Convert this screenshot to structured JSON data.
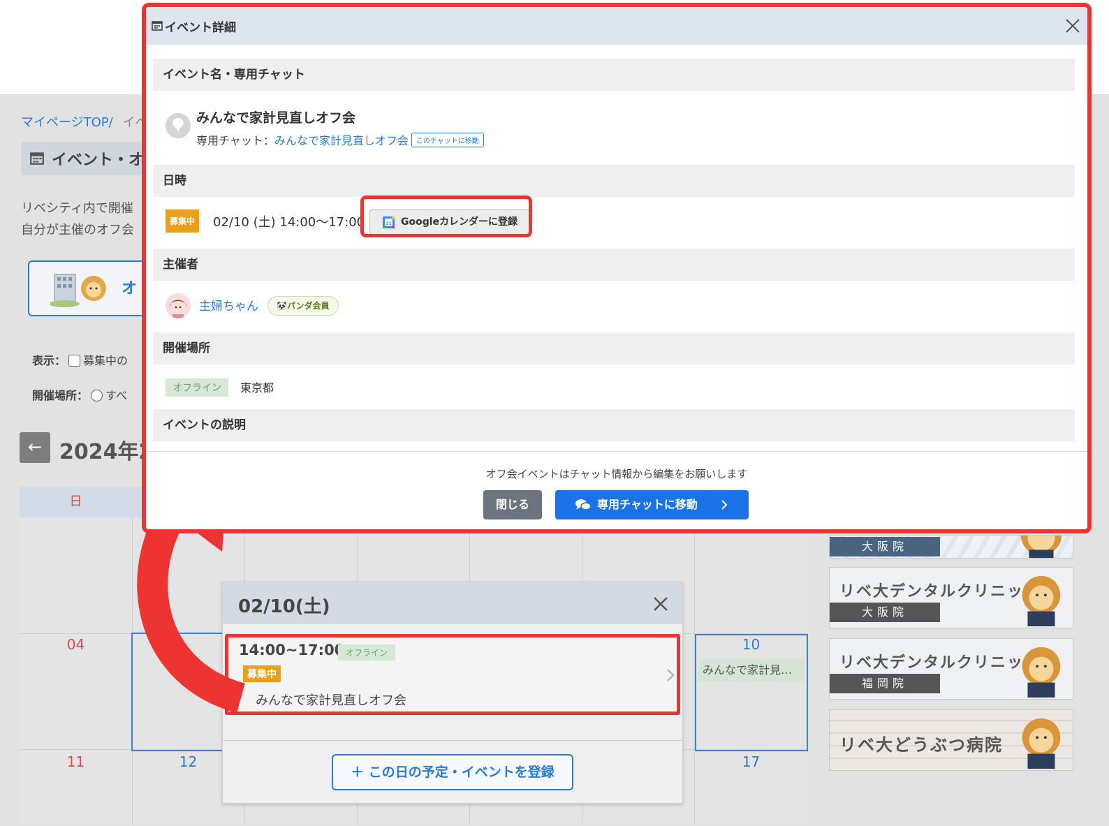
{
  "background": {
    "breadcrumb": {
      "top": "マイページTOP/",
      "next": "イベ"
    },
    "page_title": "イベント・オ",
    "intro": [
      "リベシティ内で開催",
      "自分が主催のオフ会"
    ],
    "banner_text": "オ",
    "filter": {
      "display_label": "表示：",
      "display_option": "募集中の",
      "location_label": "開催場所：",
      "location_option": "すべ"
    },
    "prev_arrow": "←",
    "month_title": "2024年2",
    "weekday_sun": "日",
    "days": {
      "d04": "04",
      "d10": "10",
      "d11": "11",
      "d12": "12",
      "d17": "17"
    },
    "calendar_event": "みんなで家計見…",
    "side_banners": [
      {
        "name": "",
        "branch": "大阪院"
      },
      {
        "name": "リベ大デンタルクリニック",
        "branch": "大阪院"
      },
      {
        "name": "リベ大デンタルクリニック",
        "branch": "福岡院"
      },
      {
        "name": "リベ大どうぶつ病院",
        "branch": ""
      }
    ]
  },
  "day_popup": {
    "title": "02/10(土)",
    "item": {
      "time": "14:00~17:00",
      "location_tag": "オフライン",
      "status": "募集中",
      "name": "みんなで家計見直しオフ会"
    },
    "add_button": "＋ この日の予定・イベントを登録"
  },
  "modal": {
    "title": "イベント詳細",
    "sections": {
      "event": "イベント名・専用チャット",
      "datetime": "日時",
      "organizer": "主催者",
      "location": "開催場所",
      "description": "イベントの説明"
    },
    "event_name": "みんなで家計見直しオフ会",
    "chat_label": "専用チャット：",
    "chat_link": "みんなで家計見直しオフ会",
    "chat_move_small": "このチャットに移動",
    "status": "募集中",
    "datetime_text": "02/10 (土) 14:00〜17:00",
    "gcal_button": "Googleカレンダーに登録",
    "organizer_name": "主婦ちゃん",
    "member_badge": "パンダ会員",
    "location_tag": "オフライン",
    "location_name": "東京都",
    "footer_note": "オフ会イベントはチャット情報から編集をお願いします",
    "close_button": "閉じる",
    "chat_button": "専用チャットに移動"
  },
  "colors": {
    "accent": "#1a73e8",
    "highlight": "#ee3333",
    "status": "#e9a01a",
    "offline": "#d6e9d6"
  }
}
